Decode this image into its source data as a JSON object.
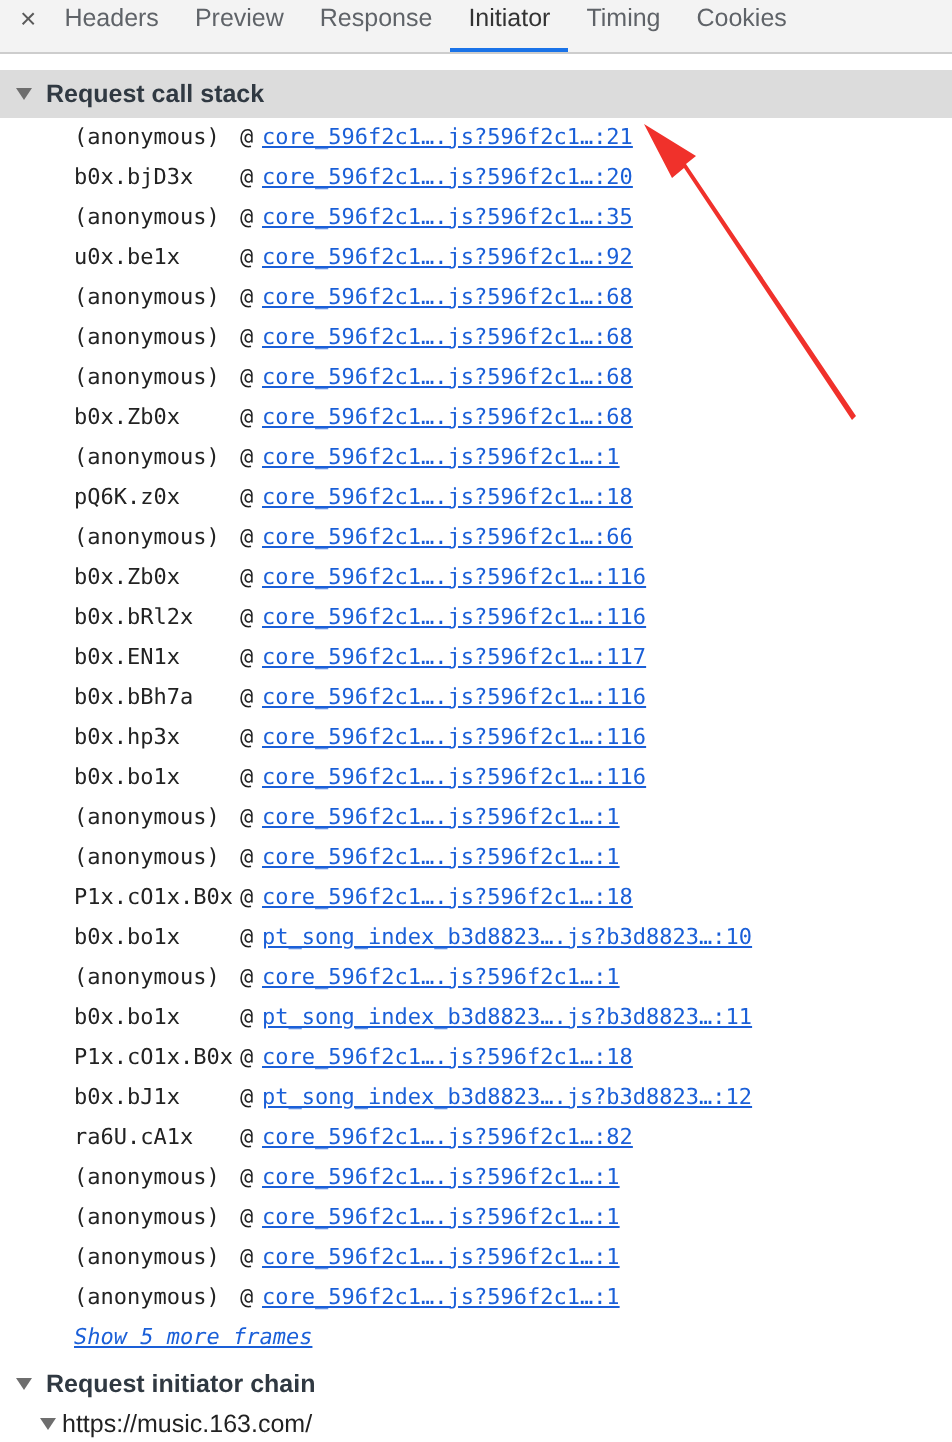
{
  "tabs": [
    {
      "label": "Headers",
      "selected": false
    },
    {
      "label": "Preview",
      "selected": false
    },
    {
      "label": "Response",
      "selected": false
    },
    {
      "label": "Initiator",
      "selected": true
    },
    {
      "label": "Timing",
      "selected": false
    },
    {
      "label": "Cookies",
      "selected": false
    }
  ],
  "close_glyph": "×",
  "call_stack": {
    "title": "Request call stack",
    "expanded": true,
    "frames": [
      {
        "function": "(anonymous)",
        "at": "@",
        "source": "core_596f2c1….js?596f2c1…:21"
      },
      {
        "function": "b0x.bjD3x",
        "at": "@",
        "source": "core_596f2c1….js?596f2c1…:20"
      },
      {
        "function": "(anonymous)",
        "at": "@",
        "source": "core_596f2c1….js?596f2c1…:35"
      },
      {
        "function": "u0x.be1x",
        "at": "@",
        "source": "core_596f2c1….js?596f2c1…:92"
      },
      {
        "function": "(anonymous)",
        "at": "@",
        "source": "core_596f2c1….js?596f2c1…:68"
      },
      {
        "function": "(anonymous)",
        "at": "@",
        "source": "core_596f2c1….js?596f2c1…:68"
      },
      {
        "function": "(anonymous)",
        "at": "@",
        "source": "core_596f2c1….js?596f2c1…:68"
      },
      {
        "function": "b0x.Zb0x",
        "at": "@",
        "source": "core_596f2c1….js?596f2c1…:68"
      },
      {
        "function": "(anonymous)",
        "at": "@",
        "source": "core_596f2c1….js?596f2c1…:1"
      },
      {
        "function": "pQ6K.z0x",
        "at": "@",
        "source": "core_596f2c1….js?596f2c1…:18"
      },
      {
        "function": "(anonymous)",
        "at": "@",
        "source": "core_596f2c1….js?596f2c1…:66"
      },
      {
        "function": "b0x.Zb0x",
        "at": "@",
        "source": "core_596f2c1….js?596f2c1…:116"
      },
      {
        "function": "b0x.bRl2x",
        "at": "@",
        "source": "core_596f2c1….js?596f2c1…:116"
      },
      {
        "function": "b0x.EN1x",
        "at": "@",
        "source": "core_596f2c1….js?596f2c1…:117"
      },
      {
        "function": "b0x.bBh7a",
        "at": "@",
        "source": "core_596f2c1….js?596f2c1…:116"
      },
      {
        "function": "b0x.hp3x",
        "at": "@",
        "source": "core_596f2c1….js?596f2c1…:116"
      },
      {
        "function": "b0x.bo1x",
        "at": "@",
        "source": "core_596f2c1….js?596f2c1…:116"
      },
      {
        "function": "(anonymous)",
        "at": "@",
        "source": "core_596f2c1….js?596f2c1…:1"
      },
      {
        "function": "(anonymous)",
        "at": "@",
        "source": "core_596f2c1….js?596f2c1…:1"
      },
      {
        "function": "P1x.cO1x.B0x",
        "at": "@",
        "source": "core_596f2c1….js?596f2c1…:18"
      },
      {
        "function": "b0x.bo1x",
        "at": "@",
        "source": "pt_song_index_b3d8823….js?b3d8823…:10"
      },
      {
        "function": "(anonymous)",
        "at": "@",
        "source": "core_596f2c1….js?596f2c1…:1"
      },
      {
        "function": "b0x.bo1x",
        "at": "@",
        "source": "pt_song_index_b3d8823….js?b3d8823…:11"
      },
      {
        "function": "P1x.cO1x.B0x",
        "at": "@",
        "source": "core_596f2c1….js?596f2c1…:18"
      },
      {
        "function": "b0x.bJ1x",
        "at": "@",
        "source": "pt_song_index_b3d8823….js?b3d8823…:12"
      },
      {
        "function": "ra6U.cA1x",
        "at": "@",
        "source": "core_596f2c1….js?596f2c1…:82"
      },
      {
        "function": "(anonymous)",
        "at": "@",
        "source": "core_596f2c1….js?596f2c1…:1"
      },
      {
        "function": "(anonymous)",
        "at": "@",
        "source": "core_596f2c1….js?596f2c1…:1"
      },
      {
        "function": "(anonymous)",
        "at": "@",
        "source": "core_596f2c1….js?596f2c1…:1"
      },
      {
        "function": "(anonymous)",
        "at": "@",
        "source": "core_596f2c1….js?596f2c1…:1"
      }
    ],
    "show_more": "Show 5 more frames"
  },
  "initiator_chain": {
    "title": "Request initiator chain",
    "expanded": true,
    "items": [
      {
        "label": "https://music.163.com/",
        "expanded": true
      }
    ]
  }
}
